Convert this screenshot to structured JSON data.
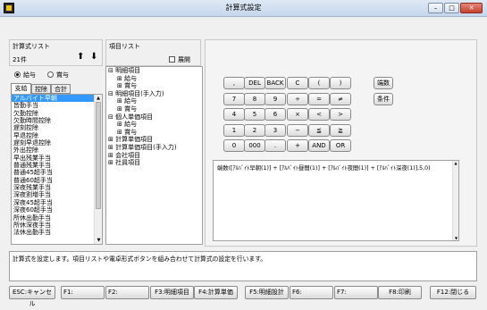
{
  "window": {
    "title": "計算式設定",
    "controls": [
      "–",
      "□",
      "✕"
    ]
  },
  "formula_list": {
    "label": "計算式リスト",
    "count": "21件",
    "up_arrow": "⬆",
    "down_arrow": "⬇"
  },
  "radio": {
    "option1": "給与",
    "option2": "賞与"
  },
  "tabs": [
    "支給",
    "控除",
    "合計"
  ],
  "item_list": {
    "items": [
      "アルバイト早朝",
      "皆勤手当",
      "欠勤控除",
      "欠勤時間控除",
      "遅刻控除",
      "早退控除",
      "遅刻早退控除",
      "外出控除",
      "早出残業手当",
      "普通残業手当",
      "普通45超手当",
      "普通60超手当",
      "深夜残業手当",
      "深夜割増手当",
      "深夜45超手当",
      "深夜60超手当",
      "所休出勤手当",
      "所休深夜手当",
      "法休出勤手当"
    ]
  },
  "tree_panel": {
    "label": "項目リスト",
    "expand_label": "展開",
    "nodes": [
      "明細項目",
      "給与",
      "賞与",
      "明細項目(手入力)",
      "給与",
      "賞与",
      "個人単価項目",
      "給与",
      "賞与",
      "計算単価項目",
      "計算単価項目(手入力)",
      "会社項目",
      "社員項目"
    ]
  },
  "calculator": {
    "rows": [
      [
        ",",
        "DEL",
        "BACK",
        "C",
        "(",
        ")"
      ],
      [
        "7",
        "8",
        "9",
        "÷",
        "=",
        "≠"
      ],
      [
        "4",
        "5",
        "6",
        "×",
        "<",
        ">"
      ],
      [
        "1",
        "2",
        "3",
        "−",
        "≦",
        "≧"
      ],
      [
        "0",
        "000",
        ".",
        "+",
        "AND",
        "OR"
      ]
    ],
    "rounding_button": "端数",
    "condition_button": "条件"
  },
  "formula": {
    "text": "端数([ｱﾙﾊﾞｲﾄ早朝(1)] + [ｱﾙﾊﾞｲﾄ昼間(1)] + [ｱﾙﾊﾞｲﾄ夜間(1)] + [ｱﾙﾊﾞｲﾄ深夜(1)],5,0)"
  },
  "message": "計算式を設定します。項目リストや電卓形式ボタンを組み合わせて計算式の設定を行います。",
  "function_keys": [
    "ESC:キャンセル",
    "F1:",
    "F2:",
    "F3:明細項目",
    "F4:計算単価",
    "F5:明細設計",
    "F6:",
    "F7:",
    "F8:印刷",
    "F12:閉じる"
  ]
}
